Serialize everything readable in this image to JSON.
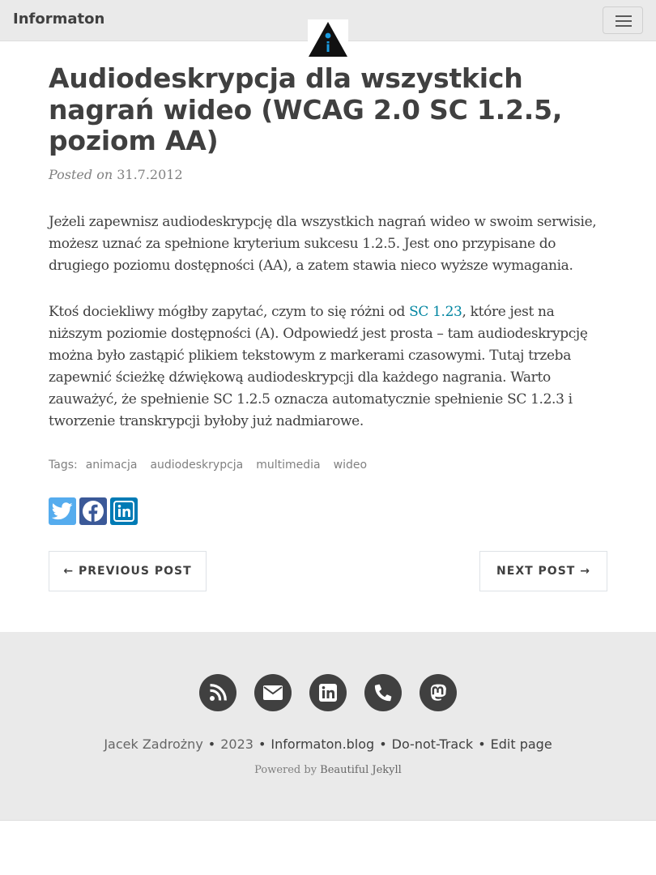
{
  "navbar": {
    "brand": "Informaton",
    "logo_glyph": "i",
    "toggle_icon": "hamburger-icon"
  },
  "post": {
    "title": "Audiodeskrypcja dla wszystkich nagrań wideo (WCAG 2.0 SC 1.2.5, poziom AA)",
    "posted_on": "Posted on",
    "date": "31.7.2012",
    "p1": "Jeżeli zapewnisz audiodeskrypcję dla wszystkich nagrań wideo w swoim serwisie, możesz uznać za spełnione kryterium sukcesu 1.2.5. Jest ono przypisane do drugiego poziomu dostępności (AA), a zatem stawia nieco wyższe wymagania.",
    "p2_before": "Ktoś dociekliwy mógłby zapytać, czym to się różni od ",
    "p2_link": "SC 1.23",
    "p2_after": ", które jest na niższym poziomie dostępności (A). Odpowiedź jest prosta – tam audiodeskrypcję można było zastąpić plikiem tekstowym z markerami czasowymi. Tutaj trzeba zapewnić ścieżkę dźwiękową audiodeskrypcji dla każdego nagrania. Warto zauważyć, że spełnienie SC 1.2.5 oznacza automatycznie spełnienie SC 1.2.3 i tworzenie transkrypcji byłoby już nadmiarowe.",
    "tags_label": "Tags:",
    "tags": [
      "animacja",
      "audiodeskrypcja",
      "multimedia",
      "wideo"
    ]
  },
  "share": [
    "twitter-icon",
    "facebook-icon",
    "linkedin-icon"
  ],
  "pager": {
    "prev": "← PREVIOUS POST",
    "next": "NEXT POST →"
  },
  "footer": {
    "icons": [
      "rss-icon",
      "envelope-icon",
      "linkedin-icon",
      "phone-icon",
      "mastodon-icon"
    ],
    "author": "Jacek Zadrożny",
    "year": "2023",
    "site": "Informaton.blog",
    "dnt": "Do-not-Track",
    "edit": "Edit page",
    "powered_prefix": "Powered by ",
    "powered_link": "Beautiful Jekyll"
  },
  "colors": {
    "link": "#0085a1",
    "twitter": "#55acee",
    "facebook": "#3b5998",
    "linkedin": "#007bb5",
    "logo_blue": "#1a9be0"
  }
}
